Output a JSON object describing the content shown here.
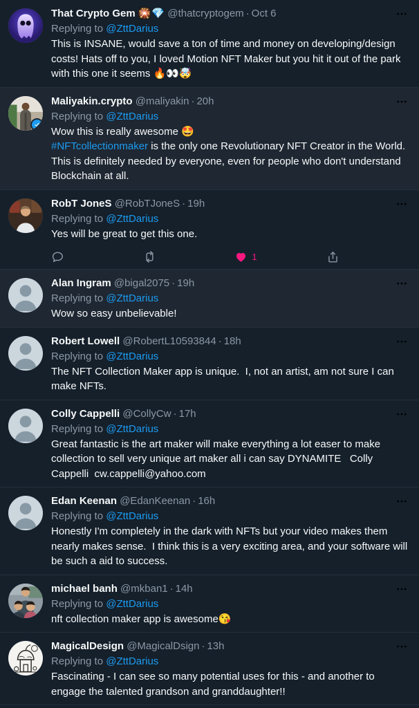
{
  "theme": {
    "background": "#15202b",
    "background_highlight": "#1e2732",
    "text_primary": "#f7f9f9",
    "text_secondary": "#8b98a5",
    "link": "#1d9bf0",
    "like_active": "#f91880",
    "divider": "#22303c"
  },
  "replying_prefix": "Replying to ",
  "reply_target": "@ZttDarius",
  "tweets": [
    {
      "display_name": "That Crypto Gem",
      "name_emoji": "🎇💎",
      "handle": "@thatcryptogem",
      "timestamp": "Oct 6",
      "verified": false,
      "avatar": "ghost-nft",
      "replying_to": "@ZttDarius",
      "text": "This is INSANE, would save a ton of time and money on developing/design costs! Hats off to you, I loved Motion NFT Maker but you hit it out of the park with this one it seems 🔥👀🤯",
      "highlight": false,
      "has_actions": false
    },
    {
      "display_name": "Maliyakin.crypto",
      "name_emoji": "",
      "handle": "@maliyakin",
      "timestamp": "20h",
      "verified": true,
      "avatar": "photo-man-standing",
      "replying_to": "@ZttDarius",
      "text_parts": [
        {
          "type": "text",
          "value": "Wow this is really awesome 🤩\n"
        },
        {
          "type": "link",
          "value": "#NFTcollectionmaker"
        },
        {
          "type": "text",
          "value": " is the only one Revolutionary NFT Creator in the World.\nThis is definitely needed by everyone, even for people who don't understand Blockchain at all."
        }
      ],
      "highlight": true,
      "has_actions": false
    },
    {
      "display_name": "RobT JoneS",
      "name_emoji": "",
      "handle": "@RobTJoneS",
      "timestamp": "19h",
      "verified": false,
      "avatar": "photo-man-white-shirt",
      "replying_to": "@ZttDarius",
      "text": "Yes will be great to get this one.",
      "highlight": false,
      "has_actions": true,
      "actions": {
        "reply_count": "",
        "retweet_count": "",
        "like_count": "1",
        "liked": true
      }
    },
    {
      "display_name": "Alan Ingram",
      "name_emoji": "",
      "handle": "@bigal2075",
      "timestamp": "19h",
      "verified": false,
      "avatar": "default",
      "replying_to": "@ZttDarius",
      "text": "Wow so easy unbelievable!",
      "highlight": true,
      "has_actions": false
    },
    {
      "display_name": "Robert Lowell",
      "name_emoji": "",
      "handle": "@RobertL10593844",
      "timestamp": "18h",
      "verified": false,
      "avatar": "default",
      "replying_to": "@ZttDarius",
      "text": "The NFT Collection Maker app is unique.  I, not an artist, am not sure I can make NFTs.",
      "highlight": false,
      "has_actions": false
    },
    {
      "display_name": "Colly Cappelli",
      "name_emoji": "",
      "handle": "@CollyCw",
      "timestamp": "17h",
      "verified": false,
      "avatar": "default",
      "replying_to": "@ZttDarius",
      "text": "Great fantastic is the art maker will make everything a lot easer to make collection to sell very unique art maker all i can say DYNAMITE   Colly Cappelli  cw.cappelli@yahoo.com",
      "highlight": false,
      "has_actions": false
    },
    {
      "display_name": "Edan Keenan",
      "name_emoji": "",
      "handle": "@EdanKeenan",
      "timestamp": "16h",
      "verified": false,
      "avatar": "default",
      "replying_to": "@ZttDarius",
      "text": "Honestly I'm completely in the dark with NFTs but your video makes them nearly makes sense.  I think this is a very exciting area, and your software will be such a aid to success.",
      "highlight": false,
      "has_actions": false
    },
    {
      "display_name": "michael banh",
      "name_emoji": "",
      "handle": "@mkban1",
      "timestamp": "14h",
      "verified": false,
      "avatar": "photo-family",
      "replying_to": "@ZttDarius",
      "text": "nft collection maker app is awesome😘",
      "highlight": false,
      "has_actions": false
    },
    {
      "display_name": "MagicalDesign",
      "name_emoji": "",
      "handle": "@MagicalDsign",
      "timestamp": "13h",
      "verified": false,
      "avatar": "mushroom-house-drawing",
      "replying_to": "@ZttDarius",
      "text": "Fascinating - I can see so many potential uses for this - and another to engage the talented grandson and granddaughter!!",
      "highlight": false,
      "has_actions": false
    }
  ]
}
